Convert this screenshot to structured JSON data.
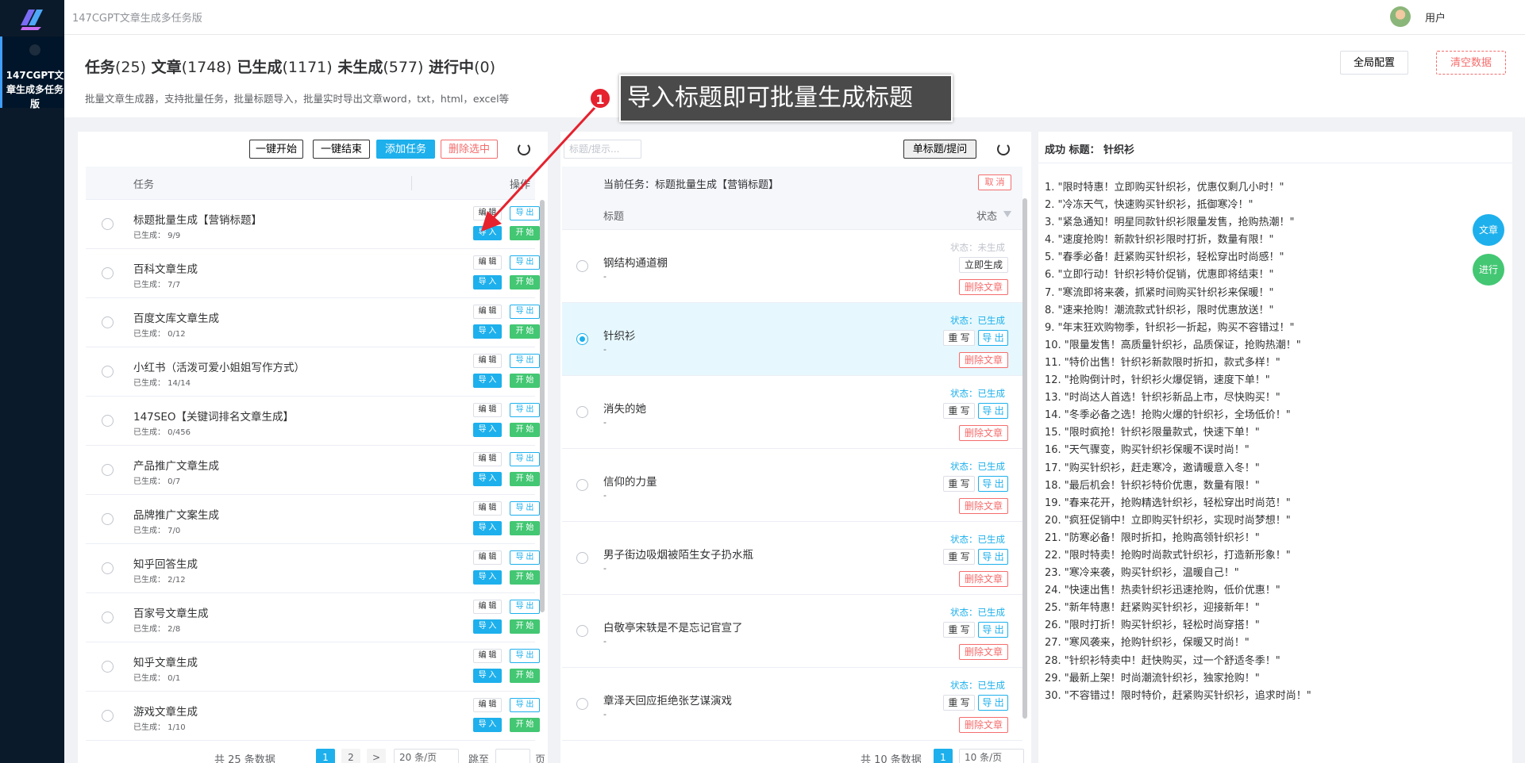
{
  "app": {
    "title": "147CGPT文章生成多任务版",
    "sidebar_label": "147CGPT文章生成多任务版",
    "user": "用户"
  },
  "header": {
    "stats": {
      "tasks_label": "任务",
      "tasks": "(25)",
      "articles_label": "文章",
      "articles": "(1748)",
      "generated_label": "已生成",
      "generated": "(1171)",
      "not_generated_label": "未生成",
      "not_generated": "(577)",
      "in_progress_label": "进行中",
      "in_progress": "(0)"
    },
    "description": "批量文章生成器，支持批量任务，批量标题导入，批量实时导出文章word，txt，html，excel等",
    "global_config": "全局配置",
    "clear_data": "清空数据"
  },
  "callout": {
    "number": "1",
    "text": "导入标题即可批量生成标题"
  },
  "tasks_panel": {
    "toolbar": {
      "start_all": "一键开始",
      "stop_all": "一键结束",
      "add_task": "添加任务",
      "delete_selected": "删除选中"
    },
    "columns": {
      "task": "任务",
      "ops": "操作"
    },
    "row_buttons": {
      "edit": "编 辑",
      "export": "导 出",
      "import": "导 入",
      "start": "开 始"
    },
    "rows": [
      {
        "name": "标题批量生成【营销标题】",
        "progress": "已生成： 9/9"
      },
      {
        "name": "百科文章生成",
        "progress": "已生成： 7/7"
      },
      {
        "name": "百度文库文章生成",
        "progress": "已生成： 0/12"
      },
      {
        "name": "小红书（活泼可爱小姐姐写作方式）",
        "progress": "已生成： 14/14"
      },
      {
        "name": "147SEO【关键词排名文章生成】",
        "progress": "已生成： 0/456"
      },
      {
        "name": "产品推广文章生成",
        "progress": "已生成： 0/7"
      },
      {
        "name": "品牌推广文案生成",
        "progress": "已生成： 7/0"
      },
      {
        "name": "知乎回答生成",
        "progress": "已生成： 2/12"
      },
      {
        "name": "百家号文章生成",
        "progress": "已生成： 2/8"
      },
      {
        "name": "知乎文章生成",
        "progress": "已生成： 0/1"
      },
      {
        "name": "游戏文章生成",
        "progress": "已生成： 1/10"
      }
    ],
    "pager": {
      "total": "共 25 条数据",
      "pages": [
        "1",
        "2"
      ],
      "next": ">",
      "page_size": "20 条/页",
      "jump": "跳至",
      "page_unit": "页"
    }
  },
  "articles_panel": {
    "search_placeholder": "标题/提示...",
    "single_button": "单标题/提问",
    "current_task": "当前任务：标题批量生成【营销标题】",
    "cancel": "取 消",
    "columns": {
      "title": "标题",
      "status": "状态"
    },
    "buttons": {
      "generate": "立即生成",
      "rewrite": "重 写",
      "export": "导 出",
      "delete": "删除文章"
    },
    "rows": [
      {
        "title": "钢结构通道棚",
        "dash": "-",
        "status": "状态：未生成",
        "generated": false,
        "selected": false
      },
      {
        "title": "针织衫",
        "dash": "-",
        "status": "状态：已生成",
        "generated": true,
        "selected": true
      },
      {
        "title": "消失的她",
        "dash": "-",
        "status": "状态：已生成",
        "generated": true,
        "selected": false
      },
      {
        "title": "信仰的力量",
        "dash": "-",
        "status": "状态：已生成",
        "generated": true,
        "selected": false
      },
      {
        "title": "男子街边吸烟被陌生女子扔水瓶",
        "dash": "-",
        "status": "状态：已生成",
        "generated": true,
        "selected": false
      },
      {
        "title": "白敬亭宋轶是不是忘记官宣了",
        "dash": "-",
        "status": "状态：已生成",
        "generated": true,
        "selected": false
      },
      {
        "title": "章泽天回应拒绝张艺谋演戏",
        "dash": "-",
        "status": "状态：已生成",
        "generated": true,
        "selected": false
      }
    ],
    "pager": {
      "total": "共 10 条数据",
      "page": "1",
      "page_size": "10 条/页"
    }
  },
  "result_panel": {
    "header": "成功 标题：  针织衫",
    "article_button": "文章",
    "progress_button": "进行",
    "lines": [
      "1. \"限时特惠！立即购买针织衫，优惠仅剩几小时！\"",
      "2. \"冷冻天气，快速购买针织衫，抵御寒冷！\"",
      "3. \"紧急通知！明星同款针织衫限量发售，抢购热潮！\"",
      "4. \"速度抢购！新款针织衫限时打折，数量有限！\"",
      "5. \"春季必备！赶紧购买针织衫，轻松穿出时尚感！\"",
      "6. \"立即行动！针织衫特价促销，优惠即将结束！\"",
      "7. \"寒流即将来袭，抓紧时间购买针织衫来保暖！\"",
      "8. \"速来抢购！潮流款式针织衫，限时优惠放送！\"",
      "9. \"年末狂欢购物季，针织衫一折起，购买不容错过！\"",
      "10. \"限量发售！高质量针织衫，品质保证，抢购热潮！\"",
      "11. \"特价出售！针织衫新款限时折扣，款式多样！\"",
      "12. \"抢购倒计时，针织衫火爆促销，速度下单！\"",
      "13. \"时尚达人首选！针织衫新品上市，尽快购买！\"",
      "14. \"冬季必备之选！抢购火爆的针织衫，全场低价！\"",
      "15. \"限时疯抢！针织衫限量款式，快速下单！\"",
      "16. \"天气骤变，购买针织衫保暖不误时尚！\"",
      "17. \"购买针织衫，赶走寒冷，邀请暖意入冬！\"",
      "18. \"最后机会！针织衫特价优惠，数量有限！\"",
      "19. \"春来花开，抢购精选针织衫，轻松穿出时尚范！\"",
      "20. \"疯狂促销中！立即购买针织衫，实现时尚梦想！\"",
      "21. \"防寒必备！限时折扣，抢购高领针织衫！\"",
      "22. \"限时特卖！抢购时尚款式针织衫，打造新形象！\"",
      "23. \"寒冷来袭，购买针织衫，温暖自己！\"",
      "24. \"快速出售！热卖针织衫迅速抢购，低价优惠！\"",
      "25. \"新年特惠！赶紧购买针织衫，迎接新年！\"",
      "26. \"限时打折！购买针织衫，轻松时尚穿搭！\"",
      "27. \"寒风袭来，抢购针织衫，保暖又时尚！\"",
      "28. \"针织衫特卖中！赶快购买，过一个舒适冬季！\"",
      "29. \"最新上架！时尚潮流针织衫，独家抢购！\"",
      "30. \"不容错过！限时特价，赶紧购买针织衫，追求时尚！\""
    ]
  },
  "colors": {
    "primary": "#1db0ec",
    "success": "#43c773",
    "danger": "#f56c6c",
    "sidebar": "#0b1a2a",
    "callout_bg": "#4a4a4a",
    "marker": "#e5222e"
  }
}
